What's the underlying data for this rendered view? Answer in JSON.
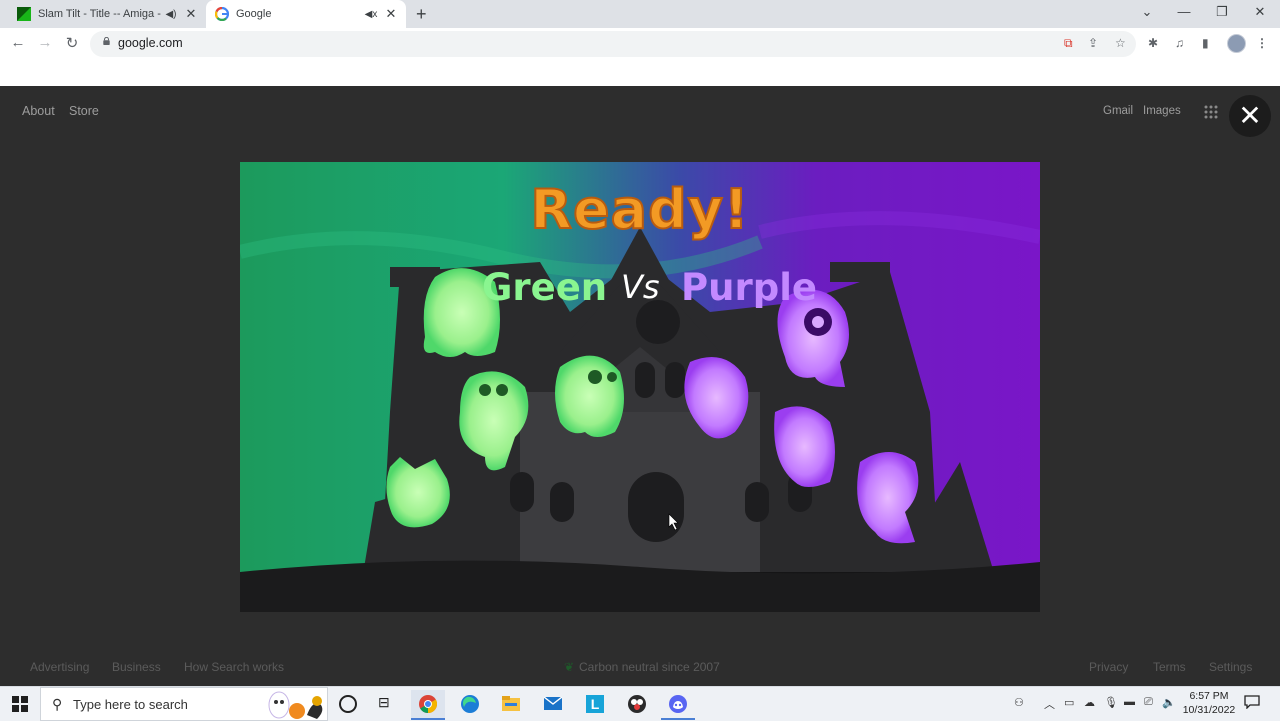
{
  "browser": {
    "tabs": [
      {
        "title": "Slam Tilt - Title -- Amiga - N",
        "active": false,
        "audio": "playing"
      },
      {
        "title": "Google",
        "active": true,
        "audio": "muted"
      }
    ],
    "address": "google.com"
  },
  "google": {
    "header_left": [
      "About",
      "Store"
    ],
    "header_right": [
      "Gmail",
      "Images"
    ],
    "footer_left": [
      "Advertising",
      "Business",
      "How Search works"
    ],
    "footer_center": "Carbon neutral since 2007",
    "footer_right": [
      "Privacy",
      "Terms",
      "Settings"
    ]
  },
  "doodle": {
    "status_text": "Ready!",
    "team_green": "Green",
    "versus": "Vs",
    "team_purple": "Purple",
    "colors": {
      "green": "#1c9a5c",
      "purple": "#7a16c8",
      "orange": "#f39a24"
    }
  },
  "taskbar": {
    "search_placeholder": "Type here to search",
    "pinned": [
      "cortana-icon",
      "task-view-icon",
      "chrome-icon",
      "edge-icon",
      "file-explorer-icon",
      "mail-icon",
      "app-l-icon",
      "obs-icon",
      "discord-icon"
    ],
    "app_l_label": "L",
    "time": "6:57 PM",
    "date": "10/31/2022"
  }
}
